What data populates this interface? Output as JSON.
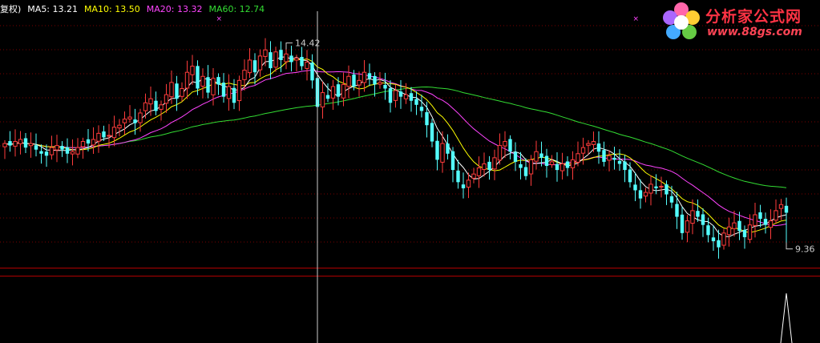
{
  "legend": {
    "prefix": "复权)",
    "ma5": "MA5: 13.21",
    "ma10": "MA10: 13.50",
    "ma20": "MA20: 13.32",
    "ma60": "MA60: 12.74"
  },
  "logo": {
    "cn": "分析家公式网",
    "url": "www.88gs.com"
  },
  "colors": {
    "background": "#000000",
    "up": "#ff3c3c",
    "down": "#54ffff",
    "ma5": "#ffffff",
    "ma10": "#ffff00",
    "ma20": "#ff44ff",
    "ma60": "#33dd33",
    "grid": "#7a0000",
    "panel_border": "#b00000",
    "crosshair": "#cccccc",
    "marker": "#ff44ff"
  },
  "chart_data": {
    "type": "candlestick",
    "price_ylim": [
      8.9,
      15.2
    ],
    "indicator_ylim": [
      0,
      1
    ],
    "high_label": "14.42",
    "low_label": "9.36",
    "high_label_candle": 54,
    "low_label_candle": 150,
    "crosshair_candle": 60,
    "markers_at_candles": [
      41,
      121
    ],
    "indicator_peak_candle": 150,
    "candles_close": [
      11.95,
      11.9,
      12.0,
      12.05,
      11.85,
      11.95,
      11.8,
      11.7,
      11.65,
      11.85,
      11.9,
      11.8,
      11.7,
      11.75,
      11.85,
      12.0,
      11.95,
      12.05,
      12.2,
      12.1,
      12.15,
      12.35,
      12.4,
      12.55,
      12.6,
      12.45,
      12.7,
      12.95,
      13.05,
      12.75,
      12.9,
      13.15,
      13.45,
      13.05,
      13.3,
      13.7,
      13.85,
      13.3,
      13.6,
      13.2,
      13.55,
      13.4,
      13.1,
      13.35,
      12.95,
      13.5,
      13.75,
      14.0,
      13.7,
      14.1,
      14.25,
      13.8,
      14.2,
      14.0,
      14.15,
      13.95,
      14.05,
      13.85,
      13.95,
      13.5,
      12.85,
      13.2,
      13.05,
      13.35,
      13.1,
      13.4,
      13.6,
      13.35,
      13.5,
      13.7,
      13.55,
      13.4,
      13.45,
      13.3,
      12.95,
      13.25,
      13.1,
      13.15,
      13.0,
      12.9,
      12.75,
      12.4,
      12.0,
      11.55,
      11.95,
      11.7,
      11.3,
      11.0,
      10.85,
      11.05,
      11.2,
      11.35,
      11.45,
      11.3,
      11.6,
      11.9,
      12.0,
      11.75,
      11.5,
      11.35,
      11.15,
      11.55,
      11.75,
      11.6,
      11.4,
      11.5,
      11.3,
      11.45,
      11.35,
      11.55,
      11.7,
      11.85,
      11.95,
      12.0,
      11.75,
      11.5,
      11.65,
      11.55,
      11.45,
      11.3,
      11.0,
      10.8,
      10.6,
      10.75,
      10.95,
      10.85,
      10.9,
      10.7,
      10.5,
      10.15,
      9.75,
      10.05,
      10.3,
      10.15,
      9.95,
      9.7,
      9.55,
      9.4,
      9.75,
      9.9,
      10.0,
      9.8,
      9.65,
      9.95,
      10.2,
      10.1,
      9.95,
      10.05,
      10.3,
      10.45,
      10.25
    ]
  }
}
